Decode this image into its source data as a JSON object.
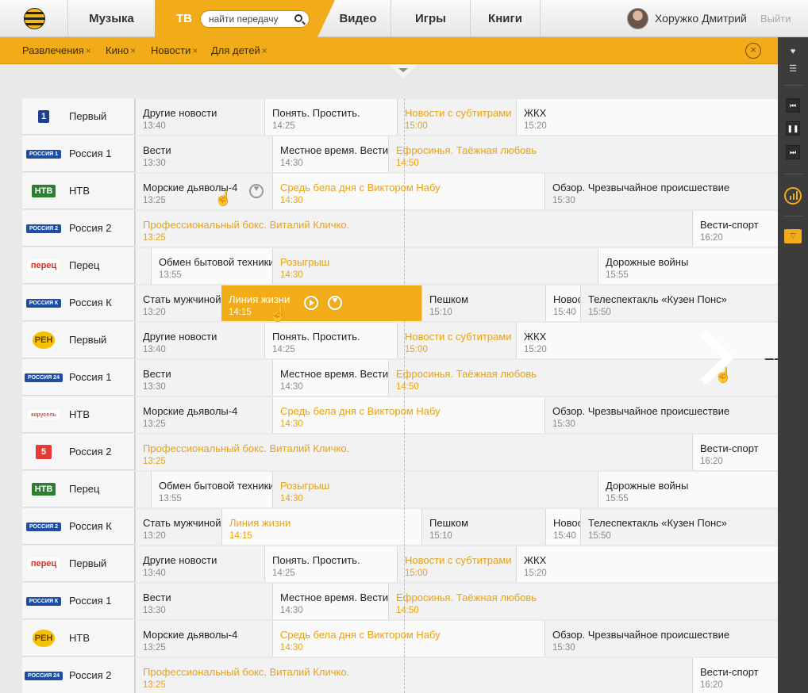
{
  "nav": {
    "music": "Музыка",
    "tv": "ТВ",
    "search_placeholder": "найти передачу",
    "video": "Видео",
    "games": "Игры",
    "books": "Книги",
    "user_name": "Хоружко Дмитрий",
    "logout": "Выйти"
  },
  "filters": [
    "Развлечения",
    "Кино",
    "Новости",
    "Для детей"
  ],
  "filter_remove": "×",
  "rows": [
    {
      "channel": "Первый",
      "logo": "perviy-logo",
      "progs": [
        {
          "title": "Другие новости",
          "time": "13:40"
        },
        {
          "title": "Понять. Простить.",
          "time": "14:25"
        },
        {
          "title": "Новости с субтитрами",
          "time": "15:00",
          "now": true
        },
        {
          "title": "ЖКХ",
          "time": "15:20"
        }
      ]
    },
    {
      "channel": "Россия 1",
      "logo": "rossiya1-logo",
      "progs": [
        {
          "title": "Вести",
          "time": "13:30"
        },
        {
          "title": "Местное время. Вести",
          "time": "14:30"
        },
        {
          "title": "Ефросинья. Таёжная любовь",
          "time": "14:50",
          "now": true
        }
      ]
    },
    {
      "channel": "НТВ",
      "logo": "ntv-logo",
      "progs": [
        {
          "title": "Морские дьяволы-4",
          "time": "13:25"
        },
        {
          "title": "Средь бела дня с Виктором Набу",
          "time": "14:30",
          "now": true
        },
        {
          "title": "Обзор. Чрезвычайное происшествие",
          "time": "15:30"
        }
      ]
    },
    {
      "channel": "Россия 2",
      "logo": "rossiya2-logo",
      "progs": [
        {
          "title": "Профессиональный бокс. Виталий Кличко.",
          "time": "13:25",
          "now": true
        },
        {
          "title": "Вести-спорт",
          "time": "16:20"
        }
      ]
    },
    {
      "channel": "Перец",
      "logo": "perets-logo",
      "progs": [
        {
          "title": "",
          "time": ""
        },
        {
          "title": "Обмен бытовой техники",
          "time": "13:55"
        },
        {
          "title": "Розыгрыш",
          "time": "14:30",
          "now": true
        },
        {
          "title": "Дорожные войны",
          "time": "15:55"
        }
      ]
    },
    {
      "channel": "Россия К",
      "logo": "rossiyak-logo",
      "progs": [
        {
          "title": "Стать мужчиной",
          "time": "13:20"
        },
        {
          "title": "Линия жизни",
          "time": "14:15",
          "now": true,
          "hl": true
        },
        {
          "title": "Пешком",
          "time": "15:10"
        },
        {
          "title": "Новости",
          "time": "15:40"
        },
        {
          "title": "Телеспектакль «Кузен Понс»",
          "time": "15:50"
        }
      ]
    },
    {
      "channel": "Первый",
      "logo": "ren-logo",
      "progs": [
        {
          "title": "Другие новости",
          "time": "13:40"
        },
        {
          "title": "Понять. Простить.",
          "time": "14:25"
        },
        {
          "title": "Новости с субтитрами",
          "time": "15:00",
          "now": true
        },
        {
          "title": "ЖКХ",
          "time": "15:20"
        }
      ]
    },
    {
      "channel": "Россия 1",
      "logo": "rossiya24-logo",
      "progs": [
        {
          "title": "Вести",
          "time": "13:30"
        },
        {
          "title": "Местное время. Вести",
          "time": "14:30"
        },
        {
          "title": "Ефросинья. Таёжная любовь",
          "time": "14:50",
          "now": true
        }
      ]
    },
    {
      "channel": "НТВ",
      "logo": "karusel-logo",
      "progs": [
        {
          "title": "Морские дьяволы-4",
          "time": "13:25"
        },
        {
          "title": "Средь бела дня с Виктором Набу",
          "time": "14:30",
          "now": true
        },
        {
          "title": "Обзор. Чрезвычайное происшествие",
          "time": "15:30"
        }
      ]
    },
    {
      "channel": "Россия 2",
      "logo": "pyaty-logo",
      "progs": [
        {
          "title": "Профессиональный бокс. Виталий Кличко.",
          "time": "13:25",
          "now": true
        },
        {
          "title": "Вести-спорт",
          "time": "16:20"
        }
      ]
    },
    {
      "channel": "Перец",
      "logo": "ntv-logo",
      "progs": [
        {
          "title": "",
          "time": ""
        },
        {
          "title": "Обмен бытовой техники",
          "time": "13:55"
        },
        {
          "title": "Розыгрыш",
          "time": "14:30",
          "now": true
        },
        {
          "title": "Дорожные войны",
          "time": "15:55"
        }
      ]
    },
    {
      "channel": "Россия К",
      "logo": "rossiya2-logo",
      "progs": [
        {
          "title": "Стать мужчиной",
          "time": "13:20"
        },
        {
          "title": "Линия жизни",
          "time": "14:15",
          "now": true
        },
        {
          "title": "Пешком",
          "time": "15:10"
        },
        {
          "title": "Новости",
          "time": "15:40"
        },
        {
          "title": "Телеспектакль «Кузен Понс»",
          "time": "15:50"
        }
      ]
    },
    {
      "channel": "Первый",
      "logo": "perets-logo",
      "progs": [
        {
          "title": "Другие новости",
          "time": "13:40"
        },
        {
          "title": "Понять. Простить.",
          "time": "14:25"
        },
        {
          "title": "Новости с субтитрами",
          "time": "15:00",
          "now": true
        },
        {
          "title": "ЖКХ",
          "time": "15:20"
        }
      ]
    },
    {
      "channel": "Россия 1",
      "logo": "rossiyak-logo",
      "progs": [
        {
          "title": "Вести",
          "time": "13:30"
        },
        {
          "title": "Местное время. Вести",
          "time": "14:30"
        },
        {
          "title": "Ефросинья. Таёжная любовь",
          "time": "14:50",
          "now": true
        }
      ]
    },
    {
      "channel": "НТВ",
      "logo": "ren-logo",
      "progs": [
        {
          "title": "Морские дьяволы-4",
          "time": "13:25"
        },
        {
          "title": "Средь бела дня с Виктором Набу",
          "time": "14:30",
          "now": true
        },
        {
          "title": "Обзор. Чрезвычайное происшествие",
          "time": "15:30"
        }
      ]
    },
    {
      "channel": "Россия 2",
      "logo": "rossiya24-logo",
      "progs": [
        {
          "title": "Профессиональный бокс. Виталий Кличко.",
          "time": "13:25",
          "now": true
        },
        {
          "title": "Вести-спорт",
          "time": "16:20"
        }
      ]
    }
  ],
  "logos": {
    "perviy-logo": {
      "text": "1",
      "bg": "#1c3f8f",
      "fg": "#ffffff"
    },
    "rossiya1-logo": {
      "text": "РОССИЯ 1",
      "bg": "#1d4ea3",
      "fg": "#ffffff"
    },
    "rossiya2-logo": {
      "text": "РОССИЯ 2",
      "bg": "#1d4ea3",
      "fg": "#ffffff"
    },
    "rossiyak-logo": {
      "text": "РОССИЯ К",
      "bg": "#1d4ea3",
      "fg": "#ffffff"
    },
    "rossiya24-logo": {
      "text": "РОССИЯ 24",
      "bg": "#1d4ea3",
      "fg": "#ffffff"
    },
    "ntv-logo": {
      "text": "НТВ",
      "bg": "#2e7d32",
      "fg": "#ffffff"
    },
    "perets-logo": {
      "text": "перец",
      "bg": "#ffffff",
      "fg": "#d62d20"
    },
    "ren-logo": {
      "text": "РЕН",
      "bg": "#f2c200",
      "fg": "#6b3d00"
    },
    "karusel-logo": {
      "text": "карусель",
      "bg": "#ffffff",
      "fg": "#e04e39"
    },
    "pyaty-logo": {
      "text": "5",
      "bg": "#e53935",
      "fg": "#ffffff"
    }
  },
  "colors": {
    "accent": "#f2ac1a",
    "now_text": "#e8a215"
  }
}
